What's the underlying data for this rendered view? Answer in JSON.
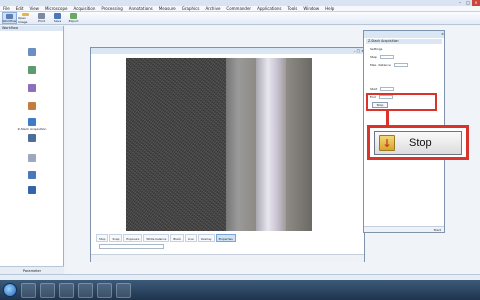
{
  "app": {
    "title": "",
    "menu": [
      "File",
      "Edit",
      "View",
      "Microscope",
      "Acquisition",
      "Processing",
      "Annotations",
      "Measure",
      "Graphics",
      "Archive",
      "Commander",
      "Applications",
      "Tools",
      "Window",
      "Help"
    ],
    "ribbon": [
      "Workflow",
      "Open Image",
      "Print",
      "Save",
      "Export"
    ],
    "status_left": "",
    "status_right": ""
  },
  "left_panel": {
    "header": "Workflow",
    "items": [
      "",
      "",
      "",
      "",
      "Z-Stack Acquisition",
      "",
      "",
      "",
      ""
    ],
    "footer": "Parameter"
  },
  "image_window": {
    "title": "",
    "toolbar": [
      "Stop",
      "Snap",
      "Exposure",
      "White balance",
      "Black",
      "Live",
      "Overlay",
      "Properties"
    ],
    "combo": "",
    "status": [
      "",
      ""
    ]
  },
  "right_window": {
    "title": "",
    "section": "Z-Stack Acquisition",
    "rows": [
      {
        "label": "Settings",
        "value": ""
      },
      {
        "label": "Step",
        "value": ""
      },
      {
        "label": "Max. distance",
        "value": ""
      },
      {
        "label": "Start",
        "value": ""
      },
      {
        "label": "End",
        "value": ""
      }
    ],
    "stop_small": "Stop",
    "footer": "Start"
  },
  "callout": {
    "stop_label": "Stop",
    "icon": "arrow-down-icon"
  },
  "colors": {
    "highlight": "#d9342b",
    "taskbar": "#1f344d"
  },
  "taskbar": {
    "time": "",
    "date": ""
  }
}
